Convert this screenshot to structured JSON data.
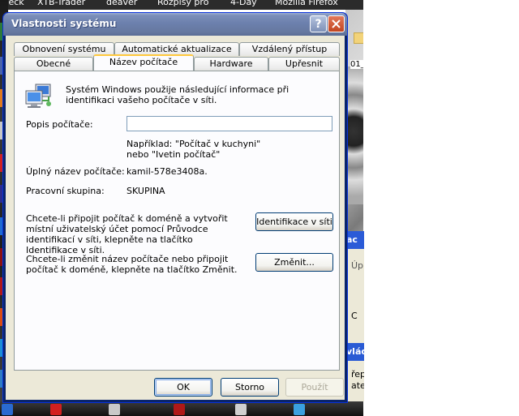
{
  "desktop": {
    "top_labels": [
      "Deck",
      "XTB-Trader",
      "deaver",
      "Rozpisy pro",
      "4-Day",
      "Mozilla Firefox"
    ],
    "folder_label": "01_",
    "behind_window": {
      "title_fragment": "ac",
      "text1": "Úp",
      "text2": "C",
      "heading": "vlád",
      "text3": "řepr",
      "text4": "ateg"
    }
  },
  "dialog": {
    "title": "Vlastnosti systému",
    "tabs_row1": [
      "Obnovení systému",
      "Automatické aktualizace",
      "Vzdálený přístup"
    ],
    "tabs_row2": [
      "Obecné",
      "Název počítače",
      "Hardware",
      "Upřesnit"
    ],
    "active_tab": "Název počítače",
    "intro": "Systém Windows použije následující informace při identifikaci vašeho počítače v síti.",
    "description_label": "Popis počítače:",
    "description_value": "",
    "example_line1": "Například: \"Počítač v kuchyni\"",
    "example_line2": "nebo \"Ivetin počítač\"",
    "full_name_label": "Úplný název počítače:",
    "full_name_value": "kamil-578e3408a.",
    "workgroup_label": "Pracovní skupina:",
    "workgroup_value": "SKUPINA",
    "domain_text": "Chcete-li připojit počítač k doméně a vytvořit místní uživatelský účet pomocí Průvodce identifikací v síti, klepněte na tlačítko Identifikace v síti.",
    "network_id_button": "Identifikace v síti",
    "rename_text": "Chcete-li změnit název počítače nebo připojit počítač k doméně, klepněte na tlačítko Změnit.",
    "change_button": "Změnit...",
    "ok_button": "OK",
    "cancel_button": "Storno",
    "apply_button": "Použít",
    "help_icon_text": "?"
  },
  "colors": {
    "titlebar": "#6c80ad",
    "dialog_bg": "#ece9d8",
    "panel_bg": "#fcfcfe",
    "active_tab_accent": "#ffc83c",
    "close_button": "#c24520"
  }
}
